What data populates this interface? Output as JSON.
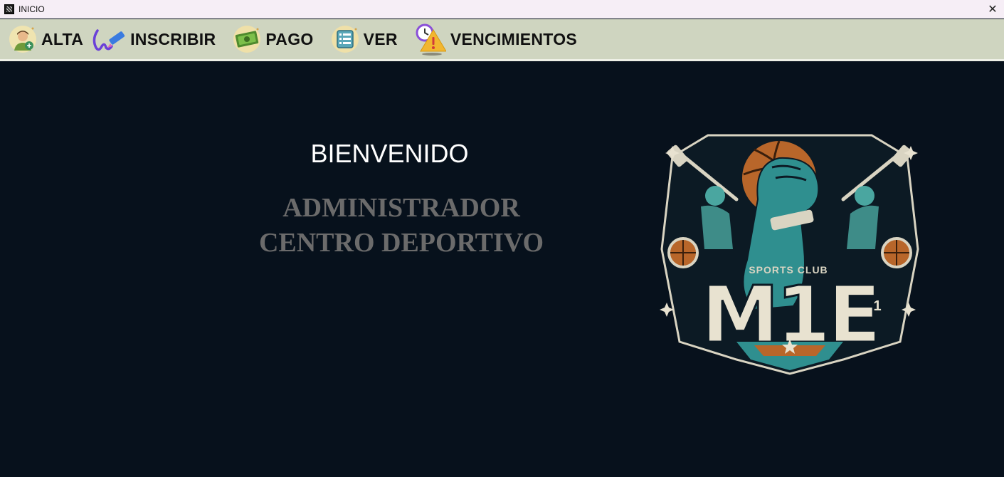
{
  "window": {
    "title": "INICIO",
    "close_label": "✕"
  },
  "menu": {
    "items": [
      {
        "label": "ALTA",
        "icon": "user-add-icon"
      },
      {
        "label": "INSCRIBIR",
        "icon": "signature-pen-icon"
      },
      {
        "label": "PAGO",
        "icon": "money-icon"
      },
      {
        "label": "VER",
        "icon": "list-view-icon"
      },
      {
        "label": "VENCIMIENTOS",
        "icon": "clock-warning-icon"
      }
    ]
  },
  "main": {
    "welcome": "BIENVENIDO",
    "subtitle_line1": "ADMINISTRADOR",
    "subtitle_line2": "CENTRO DEPORTIVO"
  },
  "logo": {
    "club_text": "SPORTS CLUB",
    "letters": "M1E",
    "number": "1"
  },
  "colors": {
    "background": "#07111c",
    "menubar": "#cfd5c0",
    "titlebar": "#f6eef6",
    "subtitle": "#6b6b6b",
    "logo_teal": "#2f8f8f",
    "logo_orange": "#b8662a"
  }
}
